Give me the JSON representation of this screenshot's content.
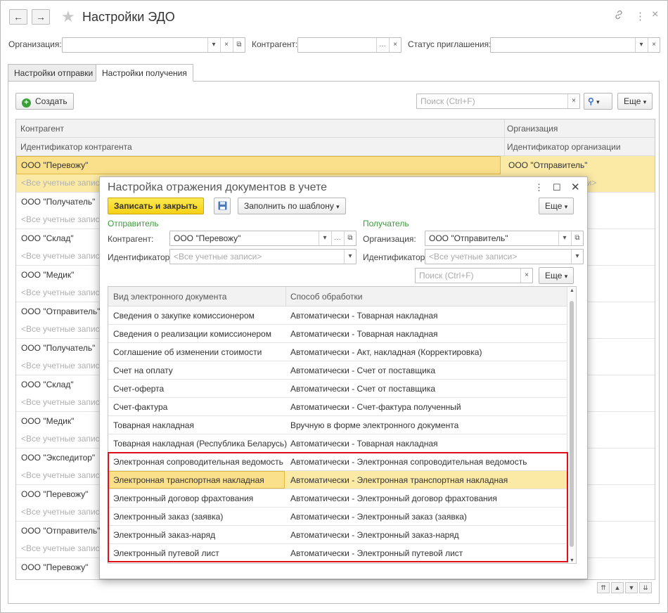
{
  "header": {
    "title": "Настройки ЭДО",
    "back_icon": "←",
    "forward_icon": "→",
    "link_icon": "🔗",
    "more_icon": "⋮",
    "close_icon": "×"
  },
  "filters": {
    "organization_label": "Организация:",
    "counterparty_label": "Контрагент:",
    "status_label": "Статус приглашения:"
  },
  "tabs": [
    {
      "label": "Настройки отправки"
    },
    {
      "label": "Настройки получения"
    }
  ],
  "toolbar": {
    "create_label": "Создать",
    "search_placeholder": "Поиск (Ctrl+F)",
    "more_label": "Еще"
  },
  "list": {
    "col1_header": "Контрагент",
    "col1_sub_header": "Идентификатор контрагента",
    "col2_header": "Организация",
    "col2_sub_header": "Идентификатор организации",
    "all_accounts_text": "<Все учетные записи>",
    "selected_org": "ООО \"Отправитель\"",
    "rows": [
      {
        "name": "ООО \"Перевожу\"",
        "sub": "<Все учетные записи>"
      },
      {
        "name": "ООО \"Получатель\"",
        "sub": "<Все учетные записи>"
      },
      {
        "name": "ООО \"Склад\"",
        "sub": "<Все учетные записи>"
      },
      {
        "name": "ООО \"Медик\"",
        "sub": "<Все учетные записи>"
      },
      {
        "name": "ООО \"Отправитель\"",
        "sub": "<Все учетные записи>"
      },
      {
        "name": "ООО \"Получатель\"",
        "sub": "<Все учетные записи>"
      },
      {
        "name": "ООО \"Склад\"",
        "sub": "<Все учетные записи>"
      },
      {
        "name": "ООО \"Медик\"",
        "sub": "<Все учетные записи>"
      },
      {
        "name": "ООО \"Экспедитор\"",
        "sub": "<Все учетные записи>"
      },
      {
        "name": "ООО \"Перевожу\"",
        "sub": "<Все учетные записи>"
      },
      {
        "name": "ООО \"Отправитель\"",
        "sub": "<Все учетные записи>"
      },
      {
        "name": "ООО \"Перевожу\"",
        "sub": "<Все учетные записи>"
      }
    ]
  },
  "modal": {
    "title": "Настройка отражения документов в учете",
    "save_close_label": "Записать и закрыть",
    "fill_template_label": "Заполнить по шаблону",
    "more_label": "Еще",
    "sender_group": "Отправитель",
    "receiver_group": "Получатель",
    "counterparty_label": "Контрагент:",
    "counterparty_value": "ООО \"Перевожу\"",
    "sender_id_label": "Идентификатор:",
    "sender_id_placeholder": "<Все учетные записи>",
    "organization_label": "Организация:",
    "organization_value": "ООО \"Отправитель\"",
    "receiver_id_label": "Идентификатор:",
    "receiver_id_placeholder": "<Все учетные записи>",
    "search_placeholder": "Поиск (Ctrl+F)",
    "table": {
      "col1": "Вид электронного документа",
      "col2": "Способ обработки",
      "rows": [
        {
          "doc": "Сведения о закупке комиссионером",
          "method": "Автоматически -  Товарная накладная"
        },
        {
          "doc": "Сведения о реализации комиссионером",
          "method": "Автоматически -  Товарная накладная"
        },
        {
          "doc": "Соглашение об изменении стоимости",
          "method": "Автоматически -  Акт, накладная (Корректировка)"
        },
        {
          "doc": "Счет на оплату",
          "method": "Автоматически -  Счет от поставщика"
        },
        {
          "doc": "Счет-оферта",
          "method": "Автоматически -  Счет от поставщика"
        },
        {
          "doc": "Счет-фактура",
          "method": "Автоматически -  Счет-фактура полученный"
        },
        {
          "doc": "Товарная накладная",
          "method": "Вручную в форме электронного документа"
        },
        {
          "doc": "Товарная накладная (Республика Беларусь)",
          "method": "Автоматически -  Товарная накладная"
        },
        {
          "doc": "Электронная сопроводительная ведомость",
          "method": "Автоматически -  Электронная сопроводительная ведомость"
        },
        {
          "doc": "Электронная транспортная накладная",
          "method": "Автоматически -  Электронная транспортная накладная"
        },
        {
          "doc": "Электронный договор фрахтования",
          "method": "Автоматически -  Электронный договор фрахтования"
        },
        {
          "doc": "Электронный заказ (заявка)",
          "method": "Автоматически -  Электронный заказ (заявка)"
        },
        {
          "doc": "Электронный заказ-наряд",
          "method": "Автоматически -  Электронный заказ-наряд"
        },
        {
          "doc": "Электронный путевой лист",
          "method": "Автоматически -  Электронный путевой лист"
        }
      ]
    }
  },
  "colors": {
    "accent_yellow": "#f4d117",
    "selection": "#fbe08c",
    "group_green": "#3c9b3c",
    "highlight_red": "#e0101b"
  }
}
